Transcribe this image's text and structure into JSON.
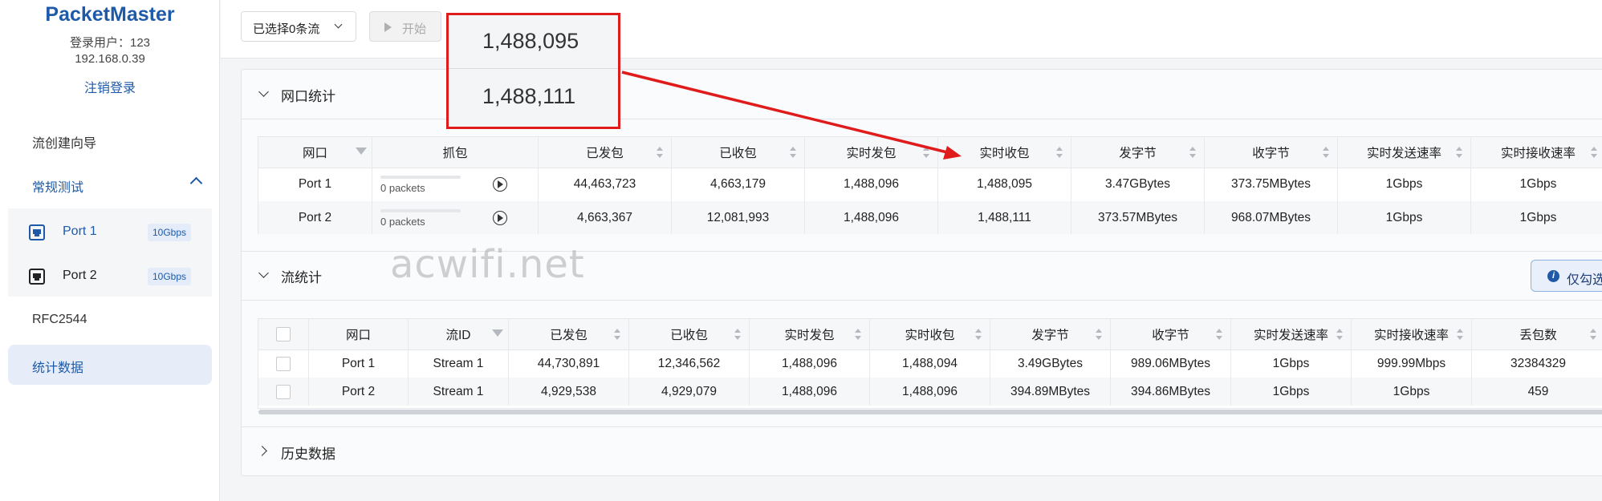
{
  "sidebar": {
    "brand": "PacketMaster",
    "login_user": "登录用户：123",
    "login_ip": "192.168.0.39",
    "logout": "注销登录",
    "nav_wizard": "流创建向导",
    "nav_group": "常规测试",
    "ports": [
      {
        "label": "Port 1",
        "speed": "10Gbps"
      },
      {
        "label": "Port 2",
        "speed": "10Gbps"
      }
    ],
    "nav_rfc": "RFC2544",
    "nav_stats": "统计数据"
  },
  "toolbar": {
    "stream_select": "已选择0条流",
    "start": "开始"
  },
  "callout": {
    "value1": "1,488,095",
    "value2": "1,488,111"
  },
  "port_stats": {
    "title": "网口统计",
    "headers": [
      "网口",
      "抓包",
      "已发包",
      "已收包",
      "实时发包",
      "实时收包",
      "发字节",
      "收字节",
      "实时发送速率",
      "实时接收速率"
    ],
    "rows": [
      {
        "port": "Port 1",
        "capture": "0 packets",
        "sent": "44,463,723",
        "recv": "4,663,179",
        "rt_sent": "1,488,096",
        "rt_recv": "1,488,095",
        "tx_bytes": "3.47GBytes",
        "rx_bytes": "373.75MBytes",
        "tx_rate": "1Gbps",
        "rx_rate": "1Gbps"
      },
      {
        "port": "Port 2",
        "capture": "0 packets",
        "sent": "4,663,367",
        "recv": "12,081,993",
        "rt_sent": "1,488,096",
        "rt_recv": "1,488,111",
        "tx_bytes": "373.57MBytes",
        "rx_bytes": "968.07MBytes",
        "tx_rate": "1Gbps",
        "rx_rate": "1Gbps"
      }
    ]
  },
  "flow_stats": {
    "title": "流统计",
    "info_button": "仅勾选",
    "headers": [
      "网口",
      "流ID",
      "已发包",
      "已收包",
      "实时发包",
      "实时收包",
      "发字节",
      "收字节",
      "实时发送速率",
      "实时接收速率",
      "丢包数"
    ],
    "rows": [
      {
        "port": "Port 1",
        "stream": "Stream 1",
        "sent": "44,730,891",
        "recv": "12,346,562",
        "rt_sent": "1,488,096",
        "rt_recv": "1,488,094",
        "tx_bytes": "3.49GBytes",
        "rx_bytes": "989.06MBytes",
        "tx_rate": "1Gbps",
        "rx_rate": "999.99Mbps",
        "loss": "32384329"
      },
      {
        "port": "Port 2",
        "stream": "Stream 1",
        "sent": "4,929,538",
        "recv": "4,929,079",
        "rt_sent": "1,488,096",
        "rt_recv": "1,488,096",
        "tx_bytes": "394.89MBytes",
        "rx_bytes": "394.86MBytes",
        "tx_rate": "1Gbps",
        "rx_rate": "1Gbps",
        "loss": "459"
      }
    ]
  },
  "history": {
    "title": "历史数据"
  },
  "watermark": "acwifi.net",
  "colors": {
    "accent": "#1e5aa8",
    "callout_border": "#e01b1b",
    "active_nav_bg": "#e6edf8"
  }
}
